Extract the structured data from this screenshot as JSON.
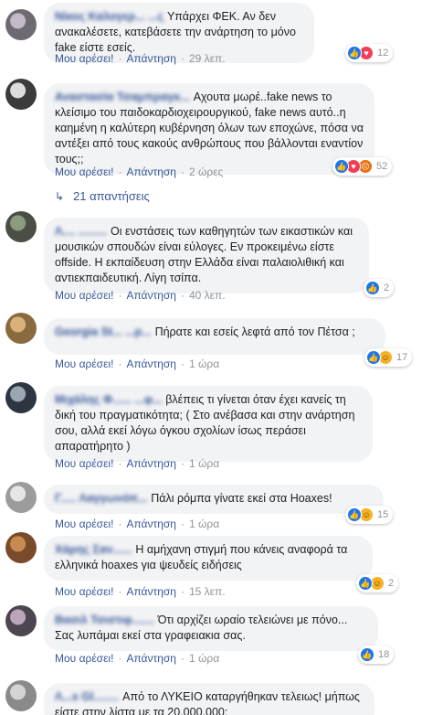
{
  "labels": {
    "like": "Μου αρέσει!",
    "reply": "Απάντηση",
    "sep": "·"
  },
  "comments": [
    {
      "author": "Νίκος Καλογερ... ...ς",
      "text": "Υπάρχει ΦΕΚ. Αν δεν ανακαλέσετε, κατεβάσετε την ανάρτηση το μόνο fake είστε εσείς.",
      "time": "29 λεπ.",
      "reactions": [
        "like-icon",
        "love-icon"
      ],
      "count": "12"
    },
    {
      "author": "Αναστασία Τσαμπραγκ...",
      "text": "Αχουτα μωρέ..fake news το κλείσιμο του παιδοκαρδιοχειρουργικού, fake news αυτό..η καημένη η καλύτερη κυβέρνηση όλων των εποχώνε, πόσα να αντέξει από τους κακούς ανθρώπους που βάλλονται εναντίον τους;;",
      "time": "2 ώρες",
      "reactions": [
        "like-icon",
        "love-icon",
        "angry-icon"
      ],
      "count": "52"
    },
    {
      "author": "Λ.... .........",
      "text": "Οι ενστάσεις των καθηγητών των εικαστικών και μουσικών σπουδών είναι εύλογες. Εν προκειμένω είστε offside. Η εκπαίδευση στην Ελλάδα είναι παλαιολιθική και αντιεκπαιδευτική. Λίγη τσίπα.",
      "time": "40 λεπ.",
      "reactions": [
        "like-icon"
      ],
      "count": "2"
    },
    {
      "author": "Georgia St... ...p...",
      "text": "Πήρατε και εσείς λεφτά από τον Πέτσα ;",
      "time": "1 ώρα",
      "reactions": [
        "like-icon",
        "haha-icon"
      ],
      "count": "17"
    },
    {
      "author": "Μιχάλης Φ...... ...φ...",
      "text": "βλέπεις τι γίνεται όταν έχει κανείς τη δική του πραγματικότητα; ( Στο ανέβασα και στην ανάρτηση σου, αλλά εκεί λόγω όγκου σχολίων ίσως περάσει απαρατήρητο )",
      "time": "1 ώρα",
      "reactions": [],
      "count": ""
    },
    {
      "author": "Γ..... Λαγγωνόπ...",
      "text": "Πάλι ρόμπα γίνατε εκεί στα Hoaxes!",
      "time": "1 ώρα",
      "reactions": [
        "like-icon",
        "haha-icon"
      ],
      "count": "15"
    },
    {
      "author": "Χάρης Σαν......",
      "text": "Η αμήχανη στιγμή που κάνεις αναφορά τα ελληνικά hoaxes για ψευδείς ειδήσεις",
      "time": "15 λεπ.",
      "reactions": [
        "like-icon",
        "haha-icon"
      ],
      "count": "2"
    },
    {
      "author": "Βασιλ Τσιστιφ.......",
      "text": "Ότι αρχίζει ωραίο τελειώνει με πόνο... Σας λυπάμαι εκεί στα γραφειακια σας.",
      "time": "1 ώρα",
      "reactions": [
        "like-icon"
      ],
      "count": "18"
    },
    {
      "author": "Λ...s Gl........",
      "text": "Από το ΛΥΚΕΙΟ καταργήθηκαν τελειως! μήπως είστε στην λίστα με τα 20.000.000;",
      "time": "",
      "reactions": [],
      "count": ""
    }
  ],
  "replies": {
    "label": "21 απαντήσεις"
  },
  "colors": {
    "link": "#385898",
    "meta": "#90949c",
    "bubble": "#f2f3f5"
  }
}
